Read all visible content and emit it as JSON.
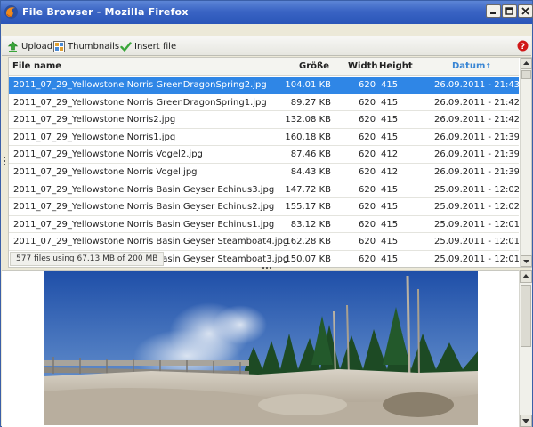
{
  "window": {
    "title": "File Browser - Mozilla Firefox"
  },
  "toolbar": {
    "upload_label": "Upload",
    "thumbnails_label": "Thumbnails",
    "insert_label": "Insert file"
  },
  "columns": {
    "name": "File name",
    "size": "Größe",
    "width": "Width",
    "height": "Height",
    "date": "Datum",
    "date_sort_indicator": "↑"
  },
  "files": [
    {
      "name": "2011_07_29_Yellowstone Norris GreenDragonSpring2.jpg",
      "size": "104.01 KB",
      "width": "620",
      "height": "415",
      "date": "26.09.2011 - 21:43",
      "selected": true
    },
    {
      "name": "2011_07_29_Yellowstone Norris GreenDragonSpring1.jpg",
      "size": "89.27 KB",
      "width": "620",
      "height": "415",
      "date": "26.09.2011 - 21:42"
    },
    {
      "name": "2011_07_29_Yellowstone Norris2.jpg",
      "size": "132.08 KB",
      "width": "620",
      "height": "415",
      "date": "26.09.2011 - 21:42"
    },
    {
      "name": "2011_07_29_Yellowstone Norris1.jpg",
      "size": "160.18 KB",
      "width": "620",
      "height": "415",
      "date": "26.09.2011 - 21:39"
    },
    {
      "name": "2011_07_29_Yellowstone Norris Vogel2.jpg",
      "size": "87.46 KB",
      "width": "620",
      "height": "412",
      "date": "26.09.2011 - 21:39"
    },
    {
      "name": "2011_07_29_Yellowstone Norris Vogel.jpg",
      "size": "84.43 KB",
      "width": "620",
      "height": "412",
      "date": "26.09.2011 - 21:39"
    },
    {
      "name": "2011_07_29_Yellowstone Norris Basin Geyser Echinus3.jpg",
      "size": "147.72 KB",
      "width": "620",
      "height": "415",
      "date": "25.09.2011 - 12:02"
    },
    {
      "name": "2011_07_29_Yellowstone Norris Basin Geyser Echinus2.jpg",
      "size": "155.17 KB",
      "width": "620",
      "height": "415",
      "date": "25.09.2011 - 12:02"
    },
    {
      "name": "2011_07_29_Yellowstone Norris Basin Geyser Echinus1.jpg",
      "size": "83.12 KB",
      "width": "620",
      "height": "415",
      "date": "25.09.2011 - 12:01"
    },
    {
      "name": "2011_07_29_Yellowstone Norris Basin Geyser Steamboat4.jpg",
      "size": "162.28 KB",
      "width": "620",
      "height": "415",
      "date": "25.09.2011 - 12:01"
    },
    {
      "name": "2011_07_29_Yellowstone Norris Basin Geyser Steamboat3.jpg",
      "size": "150.07 KB",
      "width": "620",
      "height": "415",
      "date": "25.09.2011 - 12:01"
    }
  ],
  "status": {
    "text": "577 files using 67.13 MB of 200 MB"
  },
  "colors": {
    "titlebar": "#3a64c4",
    "selection": "#2f86e6",
    "sort_column": "#3a86d4",
    "help": "#d01818",
    "upload_arrow": "#3aa63a",
    "insert_check": "#3aa63a"
  }
}
